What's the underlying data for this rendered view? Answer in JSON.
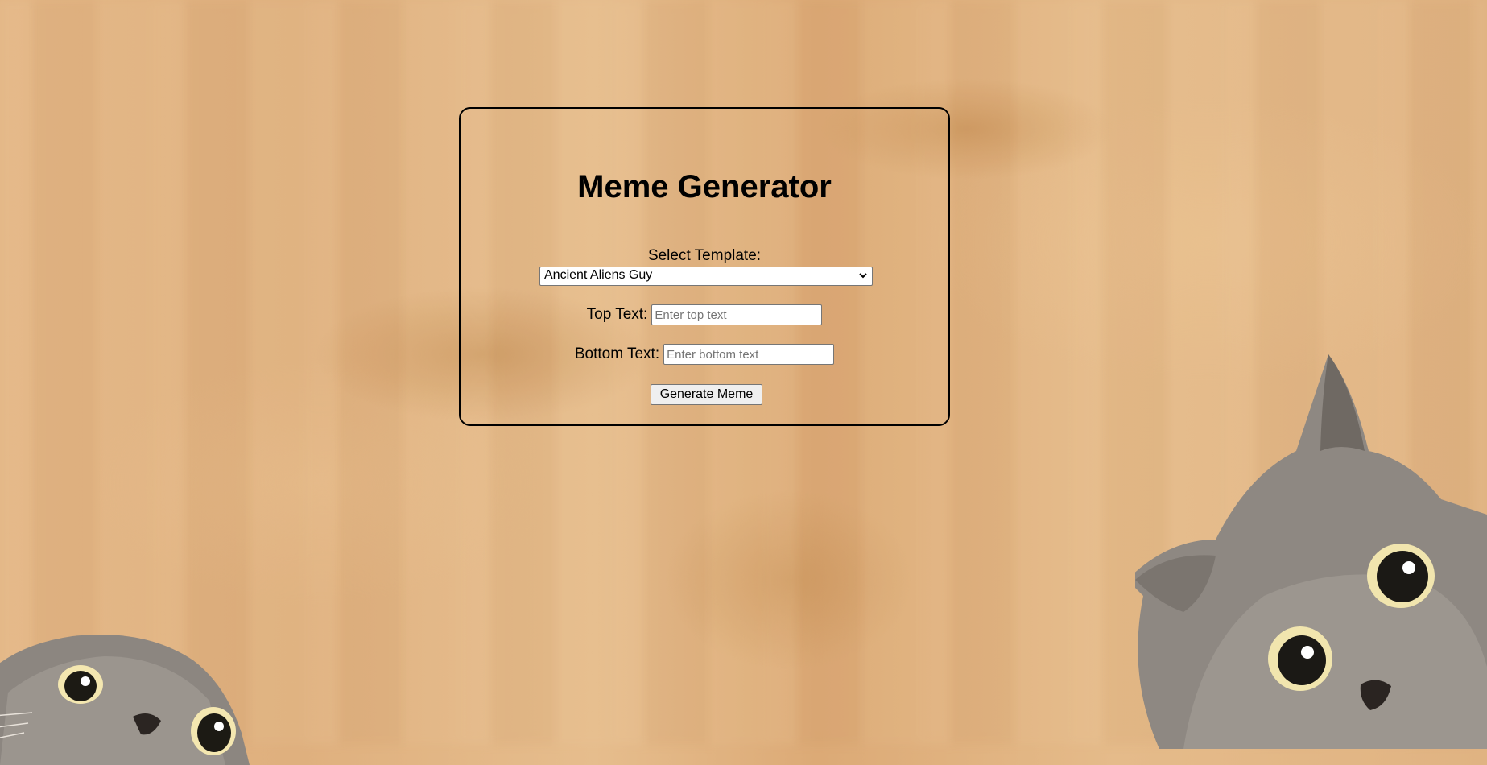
{
  "app": {
    "title": "Meme Generator"
  },
  "form": {
    "template_label": "Select Template:",
    "template_selected": "Ancient Aliens Guy",
    "top_label": "Top Text:",
    "top_placeholder": "Enter top text",
    "top_value": "",
    "bottom_label": "Bottom Text:",
    "bottom_placeholder": "Enter bottom text",
    "bottom_value": "",
    "generate_label": "Generate Meme"
  },
  "colors": {
    "background": "#e2b482",
    "card_border": "#000000",
    "button_bg": "#efefef"
  },
  "icons": {
    "select_chevron": "chevron-down-icon"
  }
}
